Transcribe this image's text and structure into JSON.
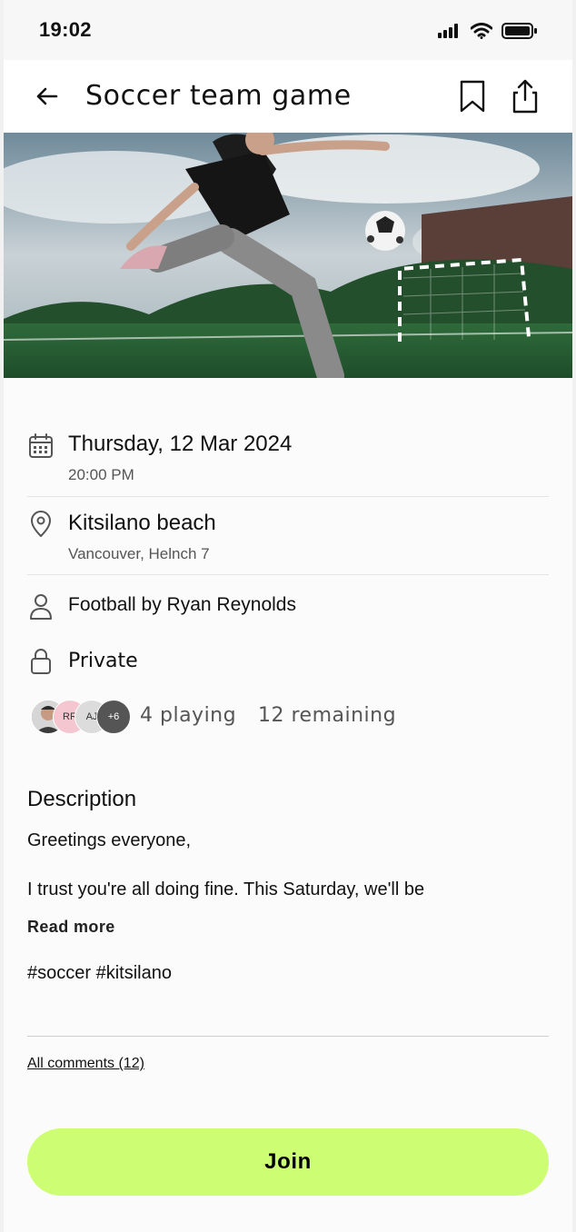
{
  "status_bar": {
    "time": "19:02"
  },
  "header": {
    "title": "Soccer team game"
  },
  "event": {
    "date": "Thursday, 12 Mar 2024",
    "time": "20:00 PM",
    "location_name": "Kitsilano beach",
    "location_address": "Vancouver, Helnch 7",
    "organizer": "Football by Ryan Reynolds",
    "privacy": "Private"
  },
  "participants": {
    "avatars": [
      {
        "initials": ""
      },
      {
        "initials": "RR"
      },
      {
        "initials": "AJ"
      },
      {
        "initials": "+6"
      }
    ],
    "playing": "4 playing",
    "remaining": "12 remaining"
  },
  "description": {
    "title": "Description",
    "line1": "Greetings everyone,",
    "line2": "I trust you're all doing fine. This Saturday, we'll be",
    "read_more": "Read more",
    "tags": "#soccer #kitsilano"
  },
  "comments": {
    "label": "All comments (12)"
  },
  "actions": {
    "join_label": "Join"
  },
  "colors": {
    "accent": "#cdfd73",
    "background": "#fbfbfb"
  },
  "icons": [
    "signal-icon",
    "wifi-icon",
    "battery-icon",
    "back-arrow-icon",
    "bookmark-icon",
    "share-icon",
    "calendar-icon",
    "location-pin-icon",
    "person-icon",
    "lock-icon"
  ]
}
